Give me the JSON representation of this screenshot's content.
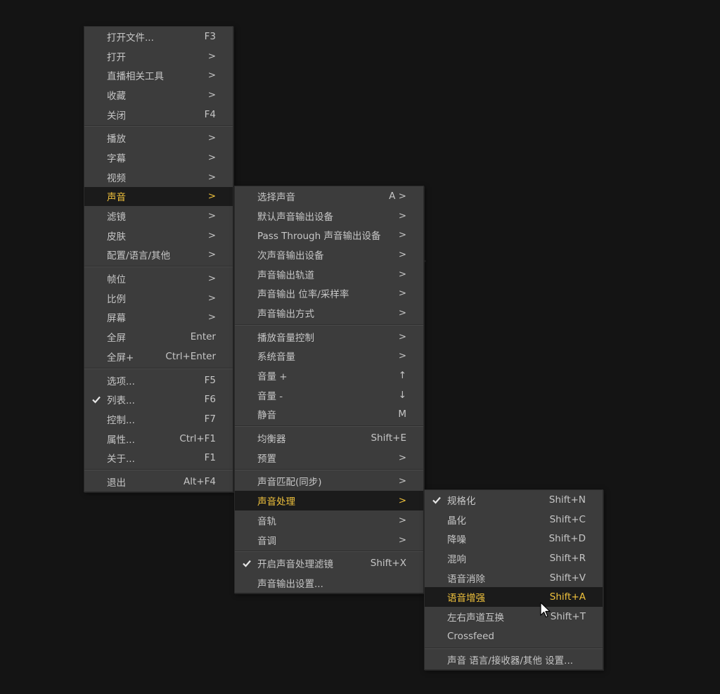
{
  "main_menu": {
    "groups": [
      [
        {
          "label": "打开文件...",
          "shortcut": "F3"
        },
        {
          "label": "打开",
          "shortcut": ">"
        },
        {
          "label": "直播相关工具",
          "shortcut": ">"
        },
        {
          "label": "收藏",
          "shortcut": ">"
        },
        {
          "label": "关闭",
          "shortcut": "F4"
        }
      ],
      [
        {
          "label": "播放",
          "shortcut": ">"
        },
        {
          "label": "字幕",
          "shortcut": ">"
        },
        {
          "label": "视频",
          "shortcut": ">"
        },
        {
          "label": "声音",
          "shortcut": ">",
          "highlighted": true
        },
        {
          "label": "滤镜",
          "shortcut": ">"
        },
        {
          "label": "皮肤",
          "shortcut": ">"
        },
        {
          "label": "配置/语言/其他",
          "shortcut": ">"
        }
      ],
      [
        {
          "label": "帧位",
          "shortcut": ">"
        },
        {
          "label": "比例",
          "shortcut": ">"
        },
        {
          "label": "屏幕",
          "shortcut": ">"
        },
        {
          "label": "全屏",
          "shortcut": "Enter"
        },
        {
          "label": "全屏+",
          "shortcut": "Ctrl+Enter"
        }
      ],
      [
        {
          "label": "选项...",
          "shortcut": "F5"
        },
        {
          "label": "列表...",
          "shortcut": "F6",
          "checked": true
        },
        {
          "label": "控制...",
          "shortcut": "F7"
        },
        {
          "label": "属性...",
          "shortcut": "Ctrl+F1"
        },
        {
          "label": "关于...",
          "shortcut": "F1"
        }
      ],
      [
        {
          "label": "退出",
          "shortcut": "Alt+F4"
        }
      ]
    ]
  },
  "audio_menu": {
    "groups": [
      [
        {
          "label": "选择声音",
          "shortcut": "A >"
        },
        {
          "label": "默认声音输出设备",
          "shortcut": ">"
        },
        {
          "label": "Pass Through 声音输出设备",
          "shortcut": ">"
        },
        {
          "label": "次声音输出设备",
          "shortcut": ">"
        },
        {
          "label": "声音输出轨道",
          "shortcut": ">"
        },
        {
          "label": "声音输出 位率/采样率",
          "shortcut": ">"
        },
        {
          "label": "声音输出方式",
          "shortcut": ">"
        }
      ],
      [
        {
          "label": "播放音量控制",
          "shortcut": ">"
        },
        {
          "label": "系统音量",
          "shortcut": ">"
        },
        {
          "label": "音量 +",
          "shortcut": "↑"
        },
        {
          "label": "音量 -",
          "shortcut": "↓"
        },
        {
          "label": "静音",
          "shortcut": "M"
        }
      ],
      [
        {
          "label": "均衡器",
          "shortcut": "Shift+E"
        },
        {
          "label": "预置",
          "shortcut": ">"
        }
      ],
      [
        {
          "label": "声音匹配(同步)",
          "shortcut": ">"
        },
        {
          "label": "声音处理",
          "shortcut": ">",
          "highlighted": true
        },
        {
          "label": "音轨",
          "shortcut": ">"
        },
        {
          "label": "音调",
          "shortcut": ">"
        }
      ],
      [
        {
          "label": "开启声音处理滤镜",
          "shortcut": "Shift+X",
          "checked": true
        },
        {
          "label": "声音输出设置...",
          "shortcut": ""
        }
      ]
    ]
  },
  "processing_menu": {
    "groups": [
      [
        {
          "label": "规格化",
          "shortcut": "Shift+N",
          "checked": true
        },
        {
          "label": "晶化",
          "shortcut": "Shift+C"
        },
        {
          "label": "降噪",
          "shortcut": "Shift+D"
        },
        {
          "label": "混响",
          "shortcut": "Shift+R"
        },
        {
          "label": "语音消除",
          "shortcut": "Shift+V"
        },
        {
          "label": "语音增强",
          "shortcut": "Shift+A",
          "highlighted": true
        },
        {
          "label": "左右声道互换",
          "shortcut": "Shift+T"
        },
        {
          "label": "Crossfeed",
          "shortcut": ""
        }
      ],
      [
        {
          "label": "声音 语言/接收器/其他 设置...",
          "shortcut": ""
        }
      ]
    ]
  },
  "background_glyph": "r",
  "colors": {
    "menu_bg": "#3c3c3c",
    "highlight_bg": "#1b1b1b",
    "highlight_text": "#f0c23c",
    "text": "#c6c6c6",
    "desktop_bg": "#141414"
  }
}
